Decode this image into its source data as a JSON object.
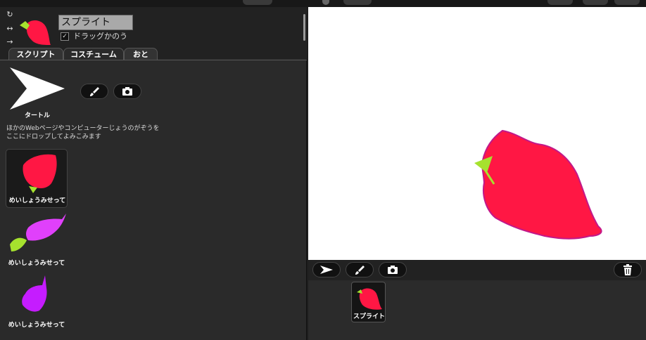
{
  "sprite": {
    "name": "スプライト",
    "draggable_label": "ドラッグかのう",
    "draggable_checked": true,
    "draggable_mark": "✓"
  },
  "tabs": [
    {
      "label": "スクリプト",
      "active": false
    },
    {
      "label": "コスチューム",
      "active": true
    },
    {
      "label": "おと",
      "active": false
    }
  ],
  "costume_panel": {
    "turtle_label": "タートル",
    "paint_icon": "brush-icon",
    "camera_icon": "camera-icon",
    "drop_hint_line1": "ほかのWebページやコンピューターじょうのがぞうを",
    "drop_hint_line2": "ここにドロップしてよみこみます"
  },
  "costumes": [
    {
      "label": "めいしょうみせって",
      "color": "#ff1744",
      "selected": true
    },
    {
      "label": "めいしょうみせって",
      "color": "#e040fb",
      "selected": false
    },
    {
      "label": "めいしょうみせって",
      "color": "#c51cff",
      "selected": false
    }
  ],
  "stage": {
    "sprite_color": "#ff1744",
    "sprite_outline": "#c2188a",
    "leaf_color": "#a6e22e"
  },
  "corral": {
    "sprite_label": "スプライト",
    "trash_icon": "trash-icon"
  }
}
